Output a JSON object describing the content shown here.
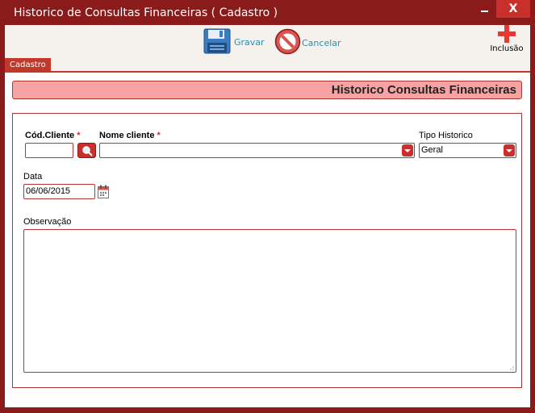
{
  "window": {
    "title": "Historico de Consultas Financeiras ( Cadastro )",
    "close_glyph": "X"
  },
  "toolbar": {
    "save_label": "Gravar",
    "cancel_label": "Cancelar",
    "add_label": "Inclusão"
  },
  "tab": {
    "label": "Cadastro"
  },
  "header": {
    "title": "Historico Consultas Financeiras"
  },
  "form": {
    "cod_cliente": {
      "label": "Cód.Cliente",
      "required_mark": "*",
      "value": ""
    },
    "nome_cliente": {
      "label": "Nome cliente",
      "required_mark": "*",
      "value": ""
    },
    "tipo_historico": {
      "label": "Tipo Historico",
      "value": "Geral"
    },
    "data": {
      "label": "Data",
      "value": "06/06/2015"
    },
    "observacao": {
      "label": "Observação",
      "value": ""
    }
  },
  "colors": {
    "frame": "#8b1a1a",
    "accent": "#c9302c",
    "header_bg": "#f7a3a3",
    "link": "#2a8fb0"
  }
}
